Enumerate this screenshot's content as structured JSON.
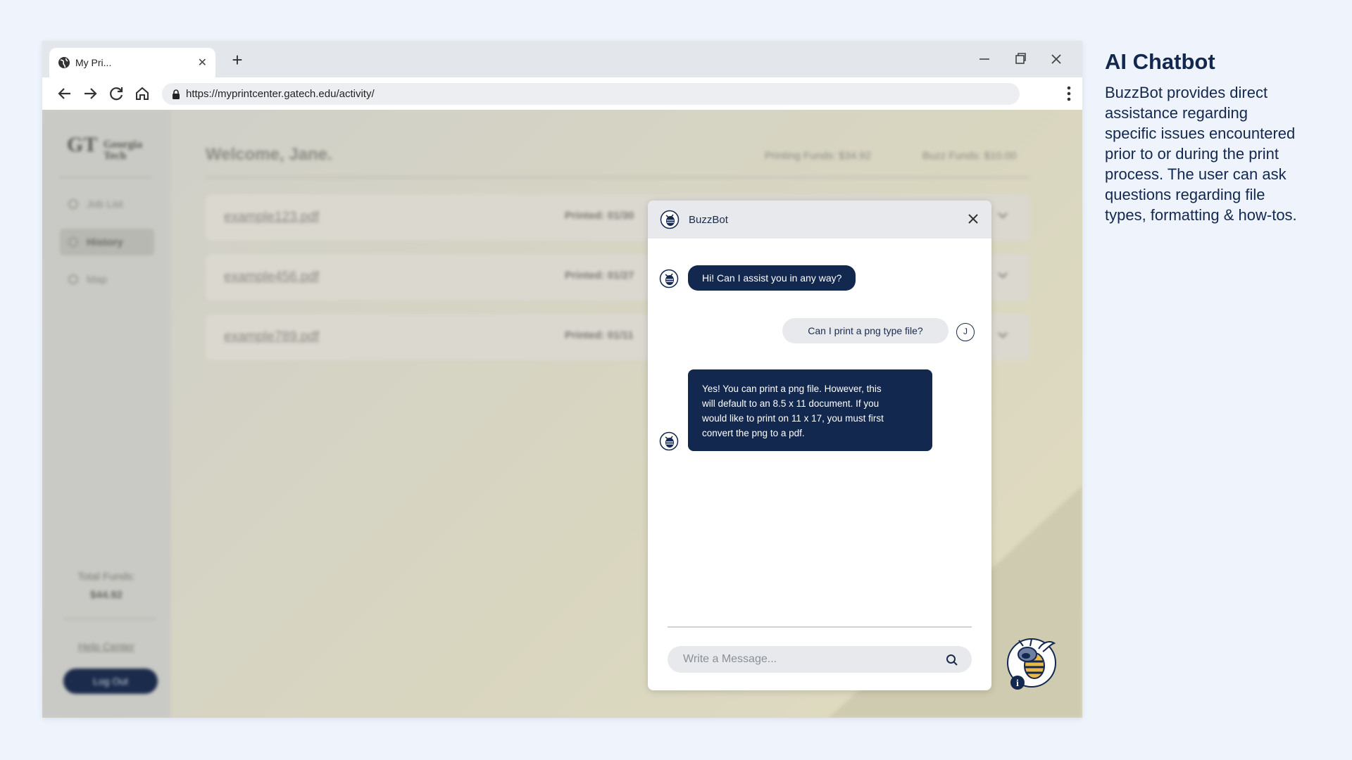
{
  "browser": {
    "tab_title": "My Pri...",
    "tab_close": "✕",
    "new_tab": "+",
    "url": "https://myprintcenter.gatech.edu/activity/"
  },
  "app": {
    "logo_text": "Georgia Tech",
    "logo_mark": "GT",
    "welcome": "Welcome, Jane.",
    "printing_funds": "Printing Funds: $34.92",
    "buzz_funds": "Buzz Funds: $10.00",
    "sidebar": {
      "items": [
        {
          "label": "Job List"
        },
        {
          "label": "History"
        },
        {
          "label": "Map"
        }
      ],
      "total_funds_label": "Total Funds:",
      "total_funds_value": "$44.92",
      "help_center": "Help Center",
      "logout": "Log Out"
    },
    "jobs": [
      {
        "file": "example123.pdf",
        "printed": "Printed: 01/30"
      },
      {
        "file": "example456.pdf",
        "printed": "Printed: 01/27"
      },
      {
        "file": "example789.pdf",
        "printed": "Printed: 01/11"
      }
    ]
  },
  "chat": {
    "title": "BuzzBot",
    "user_initial": "J",
    "messages": [
      {
        "from": "bot",
        "text": "Hi! Can I assist you in any way?"
      },
      {
        "from": "user",
        "text": "Can I print a png type file?"
      },
      {
        "from": "bot",
        "lines": [
          "Yes! You can print a png file. However, this",
          "will default to an 8.5 x 11 document. If you",
          "would like to print on 11 x 17, you must first",
          "convert the png to a pdf."
        ]
      }
    ],
    "input_placeholder": "Write a Message..."
  },
  "description": {
    "title": "AI Chatbot",
    "lines": [
      "BuzzBot provides direct",
      "assistance regarding",
      "specific issues encountered",
      "prior to or during the print",
      "process. The user can ask",
      "questions regarding file",
      "types, formatting & how-tos."
    ]
  },
  "colors": {
    "navy": "#13284f",
    "background": "#eef3fc"
  }
}
